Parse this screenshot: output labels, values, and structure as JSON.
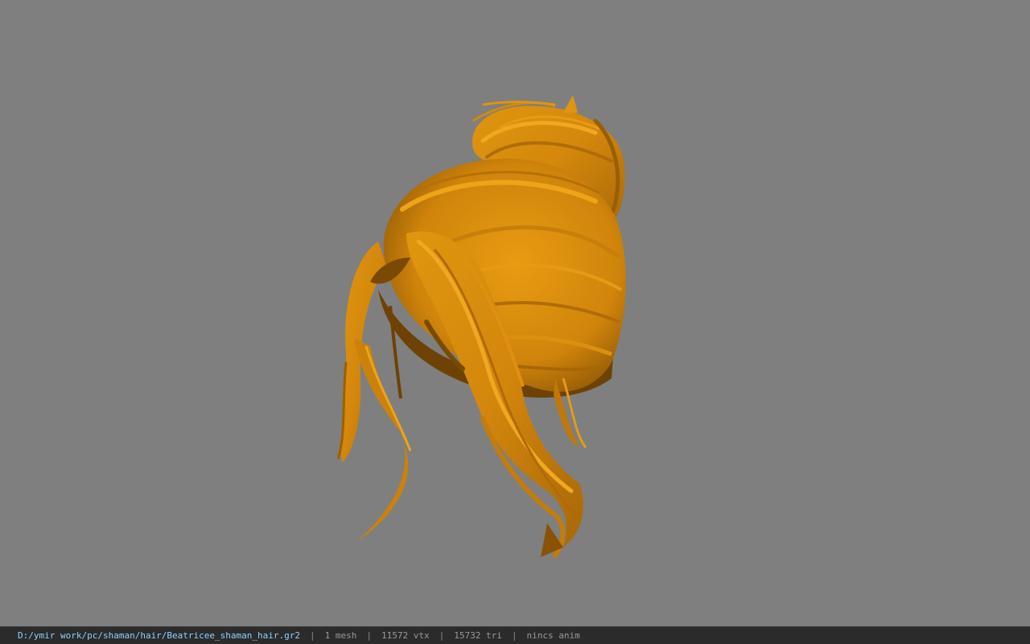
{
  "viewport": {
    "background": "#7f7f7f",
    "model_name": "Beatricee_shaman_hair",
    "model_color": "#d98a0e"
  },
  "status_bar": {
    "file_path": "D:/ymir work/pc/shaman/hair/Beatricee_shaman_hair.gr2",
    "separator": "|",
    "mesh_count": "1 mesh",
    "vertex_count": "11572 vtx",
    "triangle_count": "15732 tri",
    "anim_status": "nincs anim"
  }
}
